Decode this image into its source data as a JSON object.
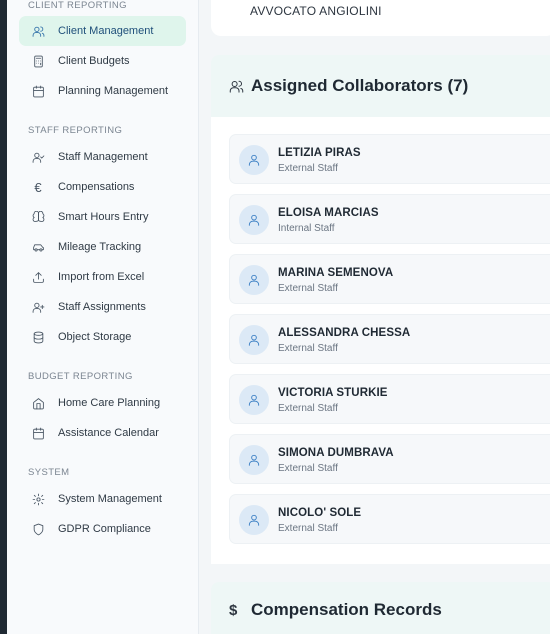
{
  "sidebar": {
    "sections": [
      {
        "title": "Client Reporting",
        "items": [
          {
            "label": "Client Management",
            "icon": "users-icon",
            "active": true
          },
          {
            "label": "Client Budgets",
            "icon": "calculator-icon",
            "active": false
          },
          {
            "label": "Planning Management",
            "icon": "calendar-icon",
            "active": false
          }
        ]
      },
      {
        "title": "Staff Reporting",
        "items": [
          {
            "label": "Staff Management",
            "icon": "user-check-icon",
            "active": false
          },
          {
            "label": "Compensations",
            "icon": "euro-icon",
            "active": false
          },
          {
            "label": "Smart Hours Entry",
            "icon": "brain-icon",
            "active": false
          },
          {
            "label": "Mileage Tracking",
            "icon": "car-icon",
            "active": false
          },
          {
            "label": "Import from Excel",
            "icon": "upload-icon",
            "active": false
          },
          {
            "label": "Staff Assignments",
            "icon": "user-plus-icon",
            "active": false
          },
          {
            "label": "Object Storage",
            "icon": "database-icon",
            "active": false
          }
        ]
      },
      {
        "title": "Budget Reporting",
        "items": [
          {
            "label": "Home Care Planning",
            "icon": "home-icon",
            "active": false
          },
          {
            "label": "Assistance Calendar",
            "icon": "calendar-icon",
            "active": false
          }
        ]
      },
      {
        "title": "System",
        "items": [
          {
            "label": "System Management",
            "icon": "gear-icon",
            "active": false
          },
          {
            "label": "GDPR Compliance",
            "icon": "shield-icon",
            "active": false
          }
        ]
      }
    ]
  },
  "main": {
    "top_card_text": "AVVOCATO ANGIOLINI",
    "collaborators_title": "Assigned Collaborators (7)",
    "collaborators": [
      {
        "name": "LETIZIA PIRAS",
        "role": "External Staff"
      },
      {
        "name": "ELOISA MARCIAS",
        "role": "Internal Staff"
      },
      {
        "name": "MARINA SEMENOVA",
        "role": "External Staff"
      },
      {
        "name": "ALESSANDRA CHESSA",
        "role": "External Staff"
      },
      {
        "name": "VICTORIA STURKIE",
        "role": "External Staff"
      },
      {
        "name": "SIMONA DUMBRAVA",
        "role": "External Staff"
      },
      {
        "name": "NICOLO' SOLE",
        "role": "External Staff"
      }
    ],
    "compensation_title": "Compensation Records"
  },
  "colors": {
    "active_nav_bg": "#dff5ec",
    "panel_header_bg": "#eef7f6",
    "avatar_bg": "#dce9f6",
    "avatar_icon": "#3b7fc4"
  }
}
